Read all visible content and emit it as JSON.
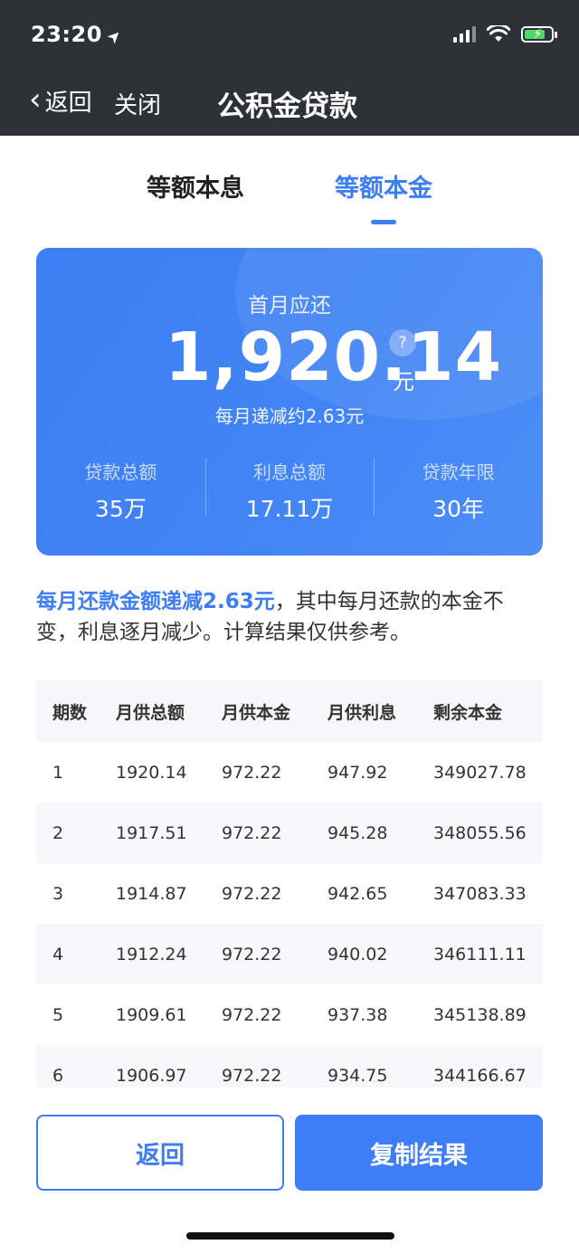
{
  "status_bar": {
    "time": "23:20",
    "location_icon": "location-arrow-icon",
    "signal_icon": "cellular-signal-icon",
    "wifi_icon": "wifi-icon",
    "battery_icon": "battery-charging-icon"
  },
  "nav": {
    "back_icon": "chevron-left-icon",
    "back_label": "返回",
    "close_label": "关闭",
    "title": "公积金贷款"
  },
  "tabs": [
    {
      "label": "等额本息",
      "active": false
    },
    {
      "label": "等额本金",
      "active": true
    }
  ],
  "summary": {
    "first_month_label": "首月应还",
    "amount": "1,920.14",
    "help": "?",
    "unit": "元",
    "monthly_decrease": "每月递减约2.63元",
    "stats": [
      {
        "label": "贷款总额",
        "value": "35万"
      },
      {
        "label": "利息总额",
        "value": "17.11万"
      },
      {
        "label": "贷款年限",
        "value": "30年"
      }
    ]
  },
  "note": {
    "highlight": "每月还款金额递减2.63元",
    "rest": "，其中每月还款的本金不变，利息逐月减少。计算结果仅供参考。"
  },
  "table": {
    "headers": [
      "期数",
      "月供总额",
      "月供本金",
      "月供利息",
      "剩余本金"
    ],
    "rows": [
      [
        "1",
        "1920.14",
        "972.22",
        "947.92",
        "349027.78"
      ],
      [
        "2",
        "1917.51",
        "972.22",
        "945.28",
        "348055.56"
      ],
      [
        "3",
        "1914.87",
        "972.22",
        "942.65",
        "347083.33"
      ],
      [
        "4",
        "1912.24",
        "972.22",
        "940.02",
        "346111.11"
      ],
      [
        "5",
        "1909.61",
        "972.22",
        "937.38",
        "345138.89"
      ],
      [
        "6",
        "1906.97",
        "972.22",
        "934.75",
        "344166.67"
      ]
    ]
  },
  "buttons": {
    "back_label": "返回",
    "copy_label": "复制结果"
  },
  "colors": {
    "accent": "#3d7df5",
    "topbar": "#2f3138",
    "card": "#4285f5"
  }
}
